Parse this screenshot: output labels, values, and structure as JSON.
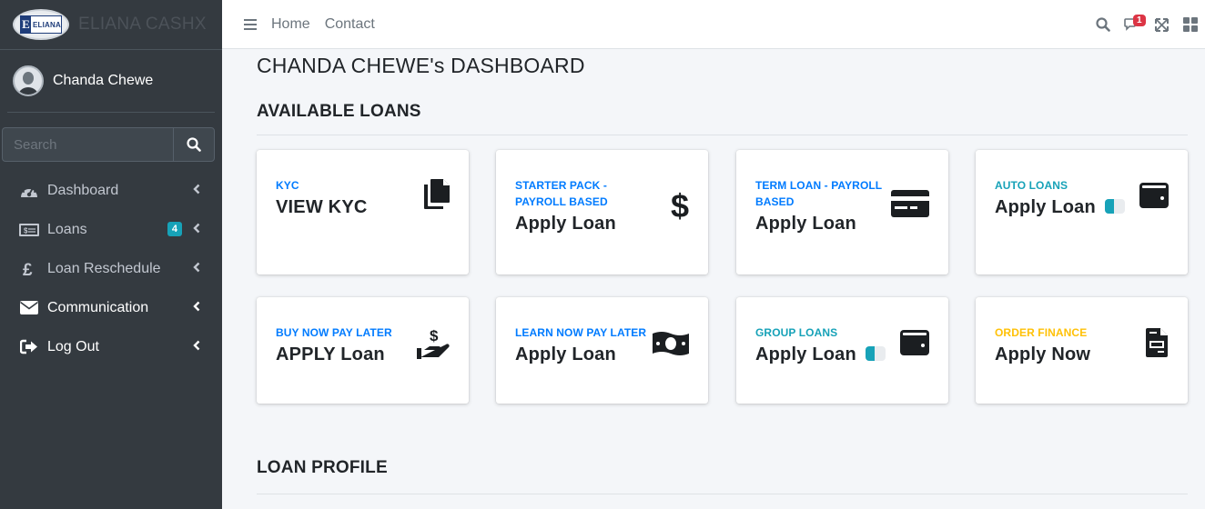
{
  "brand": {
    "name": "ELIANA CASHX",
    "logo_text": "ELIANA"
  },
  "user": {
    "name": "Chanda Chewe"
  },
  "search": {
    "placeholder": "Search"
  },
  "sidebar": {
    "items": [
      {
        "label": "Dashboard",
        "icon": "tachometer-icon"
      },
      {
        "label": "Loans",
        "icon": "money-bill-icon",
        "badge": "4"
      },
      {
        "label": "Loan Reschedule",
        "icon": "pound-sign-icon"
      },
      {
        "label": "Communication",
        "icon": "envelope-icon"
      },
      {
        "label": "Log Out",
        "icon": "sign-out-icon"
      }
    ]
  },
  "topbar": {
    "links": [
      "Home",
      "Contact"
    ],
    "notification_count": "1"
  },
  "main": {
    "title": "CHANDA CHEWE's DASHBOARD",
    "available_loans_heading": "AVAILABLE LOANS",
    "loan_profile_heading": "LOAN PROFILE"
  },
  "cards": [
    {
      "label": "KYC",
      "action": "VIEW KYC",
      "icon": "copy-icon",
      "label_color": "#007bff"
    },
    {
      "label": "STARTER PACK - PAYROLL BASED",
      "action": "Apply Loan",
      "icon": "dollar-sign-icon",
      "label_color": "#007bff"
    },
    {
      "label": "TERM LOAN - PAYROLL BASED",
      "action": "Apply Loan",
      "icon": "credit-card-icon",
      "label_color": "#007bff"
    },
    {
      "label": "AUTO LOANS",
      "action": "Apply Loan",
      "icon": "wallet-icon",
      "label_color": "#17a2b8"
    },
    {
      "label": "BUY NOW PAY LATER",
      "action": "APPLY Loan",
      "icon": "hand-holding-usd-icon",
      "label_color": "#007bff"
    },
    {
      "label": "LEARN NOW PAY LATER",
      "action": "Apply Loan",
      "icon": "money-bill-wave-icon",
      "label_color": "#007bff"
    },
    {
      "label": "GROUP LOANS",
      "action": "Apply Loan",
      "icon": "wallet-icon",
      "label_color": "#17a2b8"
    },
    {
      "label": "ORDER FINANCE",
      "action": "Apply Now",
      "icon": "file-invoice-icon",
      "label_color": "#ffc107"
    }
  ]
}
